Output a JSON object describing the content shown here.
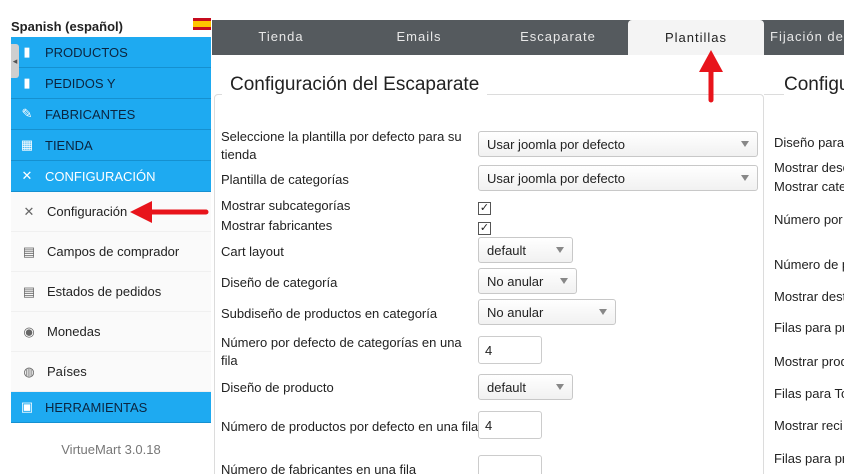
{
  "language": {
    "label": "Spanish (español)",
    "flag_icon": "spain-flag-icon"
  },
  "sidebar": {
    "menu": [
      {
        "label": "PRODUCTOS",
        "icon": "products-icon",
        "glyph": "▮"
      },
      {
        "label": "PEDIDOS Y",
        "icon": "orders-icon",
        "glyph": "▮"
      },
      {
        "label": "FABRICANTES",
        "icon": "wrench-icon",
        "glyph": "✎"
      },
      {
        "label": "TIENDA",
        "icon": "store-icon",
        "glyph": "▦"
      },
      {
        "label": "CONFIGURACIÓN",
        "icon": "config-icon",
        "glyph": "✕"
      }
    ],
    "submenu": [
      {
        "label": "Configuración",
        "icon": "tools-icon",
        "glyph": "✕"
      },
      {
        "label": "Campos de comprador",
        "icon": "form-icon",
        "glyph": "▤"
      },
      {
        "label": "Estados de pedidos",
        "icon": "document-icon",
        "glyph": "▤"
      },
      {
        "label": "Monedas",
        "icon": "coins-icon",
        "glyph": "◉"
      },
      {
        "label": "Países",
        "icon": "globe-icon",
        "glyph": "◍"
      }
    ],
    "tools": {
      "label": "HERRAMIENTAS",
      "icon": "tools-box-icon",
      "glyph": "▣"
    },
    "version": "VirtueMart 3.0.18"
  },
  "tabs": [
    {
      "label": "Tienda",
      "active": false
    },
    {
      "label": "Emails",
      "active": false
    },
    {
      "label": "Escaparate",
      "active": false
    },
    {
      "label": "Plantillas",
      "active": true
    },
    {
      "label": "Fijación de",
      "active": false
    }
  ],
  "form": {
    "legend": "Configuración del Escaparate",
    "template_label": "Seleccione la plantilla por defecto para su tienda",
    "template_value": "Usar joomla por defecto",
    "category_template_label": "Plantilla de categorías",
    "category_template_value": "Usar joomla por defecto",
    "show_subcategories_label": "Mostrar subcategorías",
    "show_subcategories_checked": "✓",
    "show_manufacturers_label": "Mostrar fabricantes",
    "show_manufacturers_checked": "✓",
    "cart_layout_label": "Cart layout",
    "cart_layout_value": "default",
    "category_design_label": "Diseño de categoría",
    "category_design_value": "No anular",
    "category_subdesign_label": "Subdiseño de productos en categoría",
    "category_subdesign_value": "No anular",
    "categories_per_row_label": "Número por defecto de categorías en una fila",
    "categories_per_row_value": "4",
    "product_design_label": "Diseño de producto",
    "product_design_value": "default",
    "products_per_row_label": "Número de productos por defecto en una fila",
    "products_per_row_value": "4",
    "manufacturers_per_row_label": "Número de fabricantes en una fila"
  },
  "right_panel": {
    "legend": "Configu",
    "labels": [
      "Diseño para",
      "Mostrar desc",
      "Mostrar cate",
      "Número por",
      "Número de p",
      "Mostrar dest",
      "Filas para pr",
      "Mostrar prod",
      "Filas para To",
      "Mostrar reci",
      "Filas para pr"
    ]
  },
  "colors": {
    "menu_bg": "#1eaaf1",
    "tab_bar": "#555a5e",
    "arrow": "#e8141b"
  }
}
